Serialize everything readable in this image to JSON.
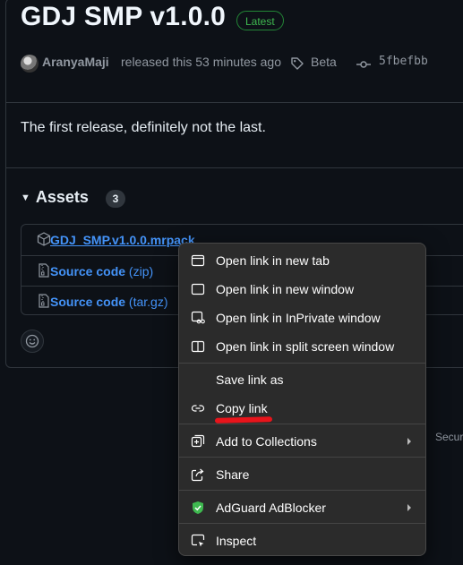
{
  "release": {
    "title": "GDJ SMP v1.0.0",
    "badge": "Latest",
    "author": "AranyaMaji",
    "released_text": "released this 53 minutes ago",
    "tag": "Beta",
    "commit": "5fbefbb",
    "description": "The first release, definitely not the last."
  },
  "assets": {
    "heading": "Assets",
    "count": "3",
    "items": [
      {
        "name": "GDJ_SMP.v1.0.0.mrpack",
        "ext": "",
        "icon": "package-icon"
      },
      {
        "name": "Source code",
        "ext": "(zip)",
        "icon": "file-zip-icon"
      },
      {
        "name": "Source code",
        "ext": "(tar.gz)",
        "icon": "file-zip-icon"
      }
    ]
  },
  "footer_partial": "Securi",
  "context_menu": {
    "items": [
      {
        "label": "Open link in new tab",
        "icon": "new-tab-icon"
      },
      {
        "label": "Open link in new window",
        "icon": "new-window-icon"
      },
      {
        "label": "Open link in InPrivate window",
        "icon": "inprivate-window-icon"
      },
      {
        "label": "Open link in split screen window",
        "icon": "split-screen-icon"
      },
      {
        "label": "Save link as",
        "icon": ""
      },
      {
        "label": "Copy link",
        "icon": "link-icon"
      },
      {
        "label": "Add to Collections",
        "icon": "collections-icon"
      },
      {
        "label": "Share",
        "icon": "share-icon"
      },
      {
        "label": "AdGuard AdBlocker",
        "icon": "adguard-shield-icon"
      },
      {
        "label": "Inspect",
        "icon": "inspect-icon"
      }
    ]
  },
  "colors": {
    "background": "#0d1117",
    "link": "#4493f8",
    "latest_badge": "#3fb950",
    "menu_bg": "#2b2b2b",
    "annotation": "#e8141b",
    "adguard": "#3fb950"
  }
}
